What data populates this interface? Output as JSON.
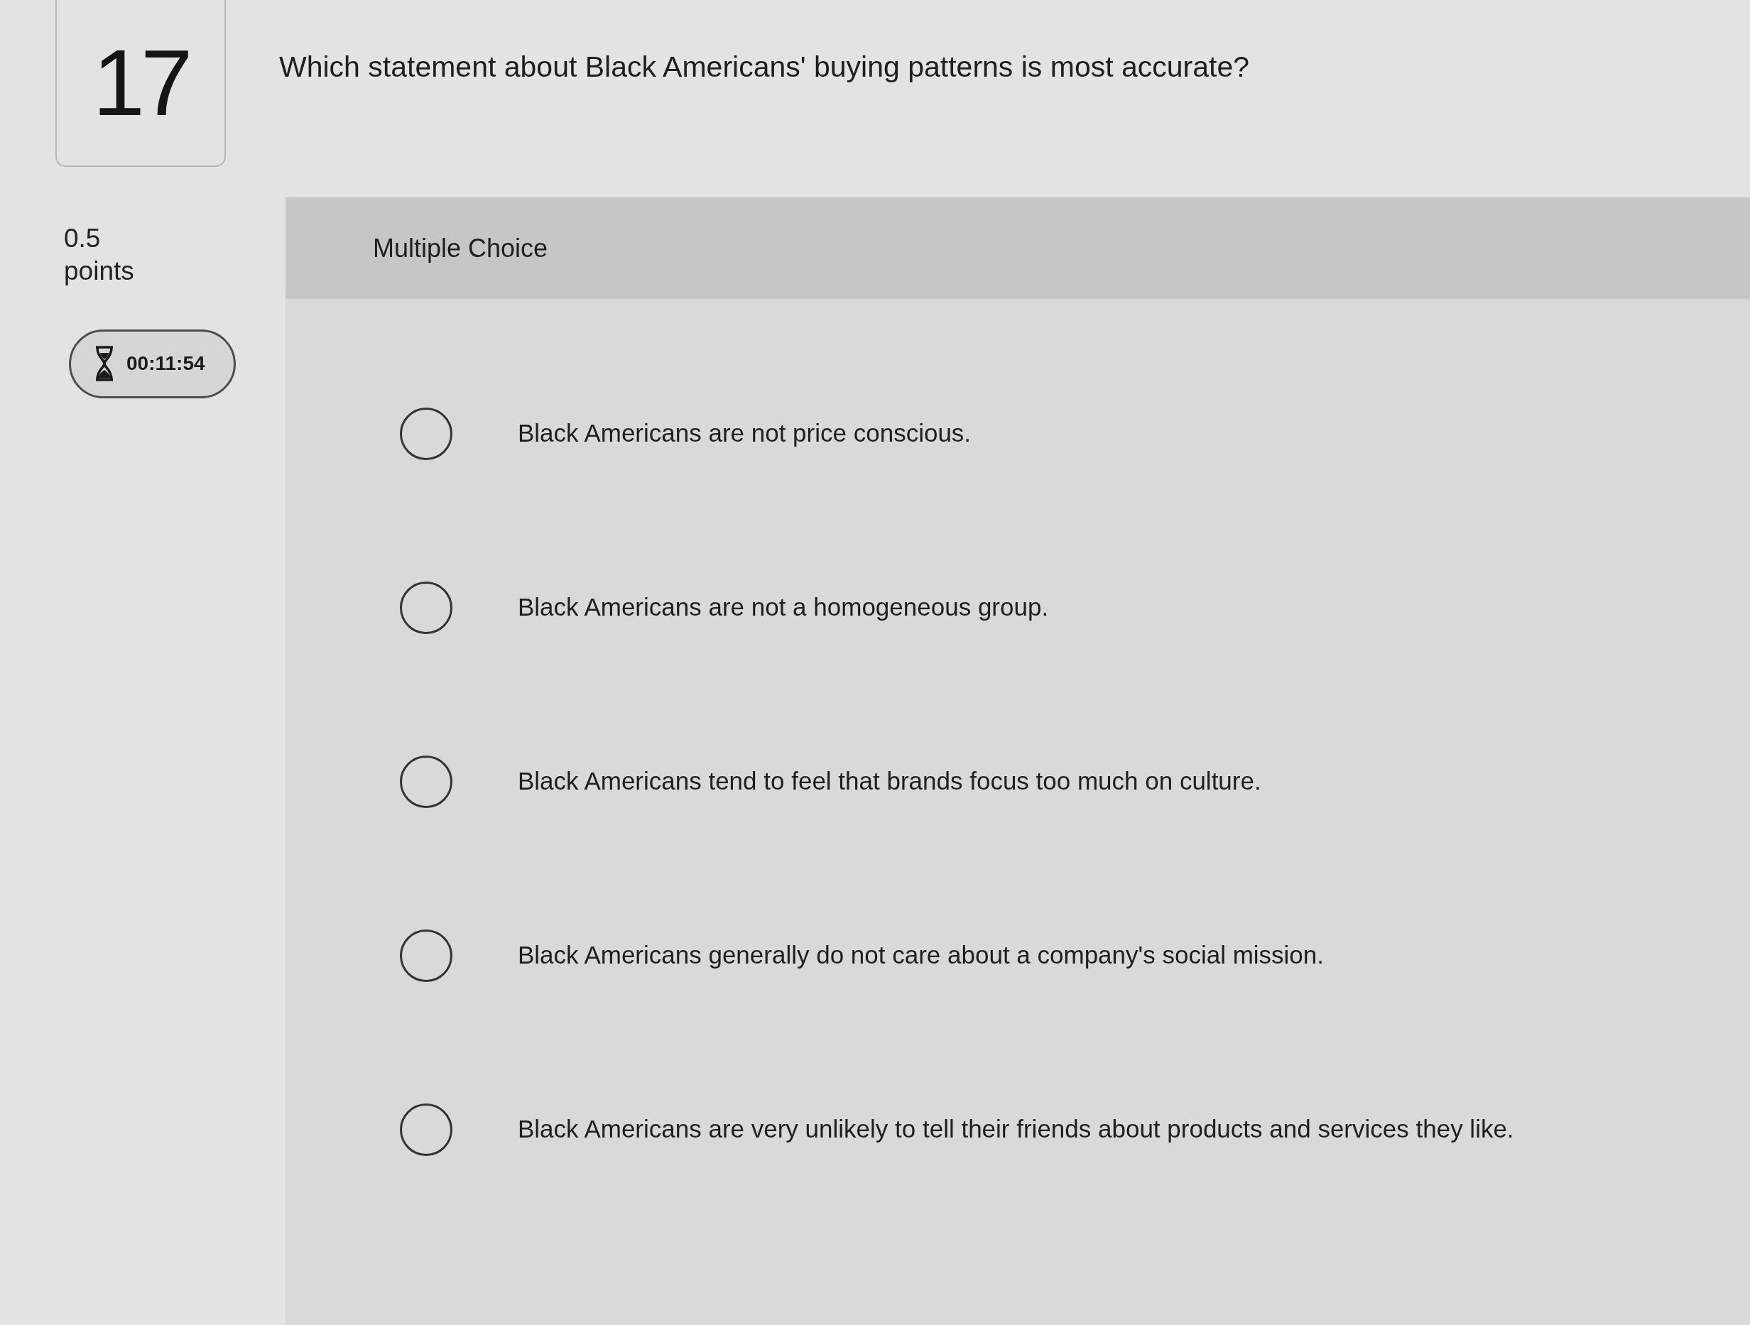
{
  "question": {
    "number": "17",
    "text": "Which statement about Black Americans' buying patterns is most accurate?",
    "points": "0.5",
    "points_label": "points",
    "timer": "00:11:54"
  },
  "answer_panel": {
    "type_label": "Multiple Choice",
    "options": [
      {
        "label": "Black Americans are not price conscious.",
        "selected": false
      },
      {
        "label": "Black Americans are not a homogeneous group.",
        "selected": false
      },
      {
        "label": "Black Americans tend to feel that brands focus too much on culture.",
        "selected": false
      },
      {
        "label": "Black Americans generally do not care about a company's social mission.",
        "selected": false
      },
      {
        "label": "Black Americans are very unlikely to tell their friends about products and services they like.",
        "selected": false
      }
    ]
  }
}
